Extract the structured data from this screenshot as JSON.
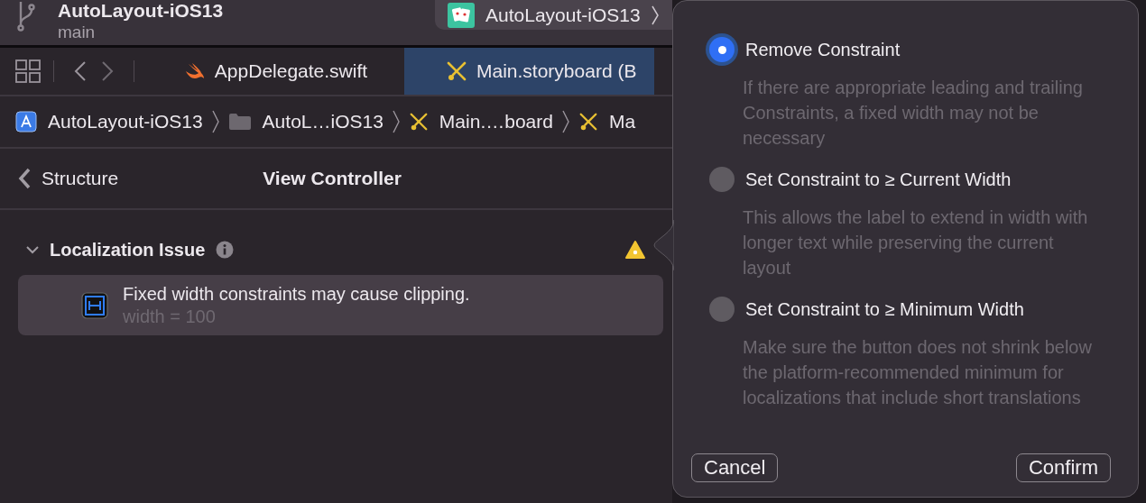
{
  "toolbar": {
    "title": "AutoLayout-iOS13",
    "branch": "main",
    "scheme": "AutoLayout-iOS13"
  },
  "tabs": [
    {
      "label": "AppDelegate.swift",
      "kind": "swift",
      "selected": false
    },
    {
      "label": "Main.storyboard (B",
      "kind": "storyboard",
      "selected": true
    }
  ],
  "breadcrumbs": [
    {
      "label": "AutoLayout-iOS13",
      "kind": "project"
    },
    {
      "label": "AutoL…iOS13",
      "kind": "folder"
    },
    {
      "label": "Main.…board",
      "kind": "storyboard"
    },
    {
      "label": "Ma",
      "kind": "storyboard"
    }
  ],
  "navigator": {
    "back": "Structure",
    "title": "View Controller"
  },
  "issue_group": {
    "title": "Localization Issue",
    "expanded": true,
    "issues": [
      {
        "message": "Fixed width constraints may cause clipping.",
        "detail": "width = 100",
        "selected": true
      }
    ]
  },
  "popover": {
    "options": [
      {
        "label": "Remove Constraint",
        "description": "If there are appropriate leading and trailing Constraints, a fixed width may not be necessary",
        "selected": true
      },
      {
        "label": "Set Constraint to ≥ Current Width",
        "description": "This allows the label to extend in width with longer text while preserving the current layout",
        "selected": false
      },
      {
        "label": "Set Constraint to ≥ Minimum Width",
        "description": "Make sure the button does not shrink below the platform-recommended minimum for localizations that include short translations",
        "selected": false
      }
    ],
    "buttons": [
      "Cancel",
      "Confirm"
    ]
  }
}
